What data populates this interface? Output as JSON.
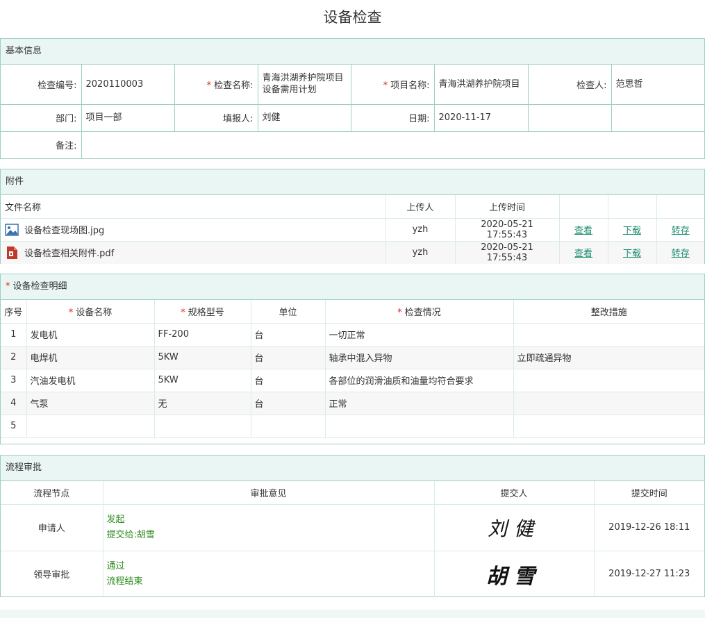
{
  "page_title": "设备检查",
  "basic": {
    "header": "基本信息",
    "check_no_label": "检查编号:",
    "check_no": "2020110003",
    "check_name_label": "检查名称:",
    "check_name": "青海洪湖养护院项目设备需用计划",
    "project_name_label": "项目名称:",
    "project_name": "青海洪湖养护院项目",
    "inspector_label": "检查人:",
    "inspector": "范思哲",
    "dept_label": "部门:",
    "dept": "项目一部",
    "reporter_label": "填报人:",
    "reporter": "刘健",
    "date_label": "日期:",
    "date": "2020-11-17",
    "remark_label": "备注:",
    "remark": ""
  },
  "attachments": {
    "header": "附件",
    "columns": [
      "文件名称",
      "上传人",
      "上传时间"
    ],
    "files": [
      {
        "name": "设备检查现场图.jpg",
        "icon": "image-file-icon",
        "uploader": "yzh",
        "time": "2020-05-21 17:55:43",
        "view": "查看",
        "download": "下载",
        "save": "转存"
      },
      {
        "name": "设备检查相关附件.pdf",
        "icon": "pdf-file-icon",
        "uploader": "yzh",
        "time": "2020-05-21 17:55:43",
        "view": "查看",
        "download": "下载",
        "save": "转存"
      }
    ]
  },
  "detail": {
    "header": "设备检查明细",
    "columns": [
      "序号",
      "设备名称",
      "规格型号",
      "单位",
      "检查情况",
      "整改措施"
    ],
    "rows": [
      {
        "no": "1",
        "name": "发电机",
        "model": "FF-200",
        "unit": "台",
        "status": "一切正常",
        "measure": ""
      },
      {
        "no": "2",
        "name": "电焊机",
        "model": "5KW",
        "unit": "台",
        "status": "轴承中混入异物",
        "measure": "立即疏通异物"
      },
      {
        "no": "3",
        "name": "汽油发电机",
        "model": "5KW",
        "unit": "台",
        "status": "各部位的润滑油质和油量均符合要求",
        "measure": ""
      },
      {
        "no": "4",
        "name": "气泵",
        "model": "无",
        "unit": "台",
        "status": "正常",
        "measure": ""
      },
      {
        "no": "5",
        "name": "",
        "model": "",
        "unit": "",
        "status": "",
        "measure": ""
      }
    ]
  },
  "flow": {
    "header": "流程审批",
    "columns": [
      "流程节点",
      "审批意见",
      "提交人",
      "提交时间"
    ],
    "rows": [
      {
        "node": "申请人",
        "opinion_1": "发起",
        "opinion_2": "提交给:胡雪",
        "signature": "刘健",
        "time": "2019-12-26 18:11"
      },
      {
        "node": "领导审批",
        "opinion_1": "通过",
        "opinion_2": "流程结束",
        "signature": "胡雪",
        "time": "2019-12-27 11:23"
      }
    ]
  }
}
